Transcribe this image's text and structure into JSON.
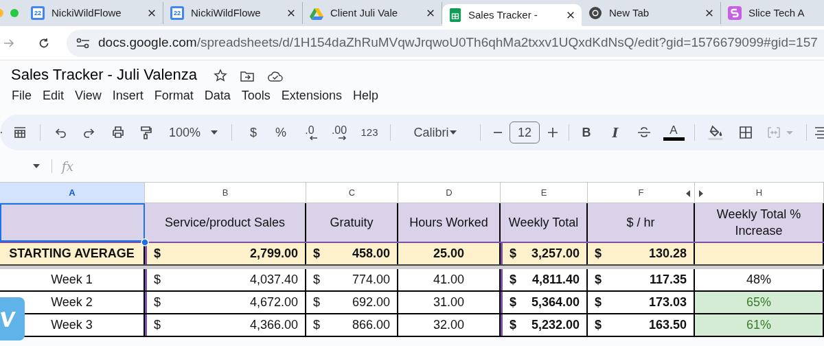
{
  "browser": {
    "tabs": [
      {
        "kind": "calendar",
        "badge": "22",
        "label": "NickiWildFlowe",
        "selected": false
      },
      {
        "kind": "calendar",
        "badge": "22",
        "label": "NickiWildFlowe",
        "selected": false
      },
      {
        "kind": "drive",
        "label": "Client Juli Vale",
        "selected": false
      },
      {
        "kind": "sheets",
        "label": "Sales Tracker -",
        "selected": true
      },
      {
        "kind": "chrome",
        "label": "New Tab",
        "selected": false
      },
      {
        "kind": "slice",
        "label": "Slice Tech A",
        "selected": false
      }
    ],
    "url": {
      "host": "docs.google.com",
      "path": "/spreadsheets/d/1H154daZhRuMVqwJrqwoU0Th6qhMa2txxv1UQxdKdNsQ/edit?gid=1576679099#gid=157"
    }
  },
  "document": {
    "title": "Sales Tracker - Juli Valenza",
    "menu": [
      "File",
      "Edit",
      "View",
      "Insert",
      "Format",
      "Data",
      "Tools",
      "Extensions",
      "Help"
    ]
  },
  "toolbar": {
    "zoom": "100%",
    "currency": "$",
    "percent": "%",
    "decrease_decimals": ".0",
    "increase_decimals": ".00",
    "number_format": "123",
    "font": "Calibri",
    "font_size": "12",
    "bold": "B",
    "italic": "I",
    "text_color": "A"
  },
  "formula_bar": {
    "function_label": "fx"
  },
  "sheet": {
    "columns": [
      {
        "label": "A",
        "selected": true
      },
      {
        "label": "B",
        "selected": false
      },
      {
        "label": "C",
        "selected": false
      },
      {
        "label": "D",
        "selected": false
      },
      {
        "label": "E",
        "selected": false
      },
      {
        "label": "F",
        "selected": false
      },
      {
        "label": "H",
        "selected": false
      }
    ],
    "header": [
      "Service/product Sales",
      "Gratuity",
      "Hours Worked",
      "Weekly Total",
      "$ / hr",
      "Weekly Total % Increase"
    ],
    "rows": [
      {
        "kind": "average",
        "cells": [
          {
            "value": "STARTING AVERAGE"
          },
          {
            "currency": "$",
            "value": "2,799.00"
          },
          {
            "currency": "$",
            "value": "458.00"
          },
          {
            "value": "25.00"
          },
          {
            "currency": "$",
            "value": "3,257.00"
          },
          {
            "currency": "$",
            "value": "130.28"
          },
          {}
        ]
      },
      {
        "kind": "week",
        "cells": [
          {
            "value": "Week 1"
          },
          {
            "currency": "$",
            "value": "4,037.40"
          },
          {
            "currency": "$",
            "value": "774.00"
          },
          {
            "value": "41.00"
          },
          {
            "currency": "$",
            "value": "4,811.40"
          },
          {
            "currency": "$",
            "value": "117.35"
          },
          {
            "value": "48%",
            "highlighted": false
          }
        ]
      },
      {
        "kind": "week",
        "cells": [
          {
            "value": "Week 2"
          },
          {
            "currency": "$",
            "value": "4,672.00"
          },
          {
            "currency": "$",
            "value": "692.00"
          },
          {
            "value": "31.00"
          },
          {
            "currency": "$",
            "value": "5,364.00"
          },
          {
            "currency": "$",
            "value": "173.03"
          },
          {
            "value": "65%",
            "highlighted": true
          }
        ]
      },
      {
        "kind": "week",
        "cells": [
          {
            "value": "Week 3"
          },
          {
            "currency": "$",
            "value": "4,366.00"
          },
          {
            "currency": "$",
            "value": "866.00"
          },
          {
            "value": "32.00"
          },
          {
            "currency": "$",
            "value": "5,232.00"
          },
          {
            "currency": "$",
            "value": "163.50"
          },
          {
            "value": "61%",
            "highlighted": true
          }
        ]
      }
    ]
  }
}
